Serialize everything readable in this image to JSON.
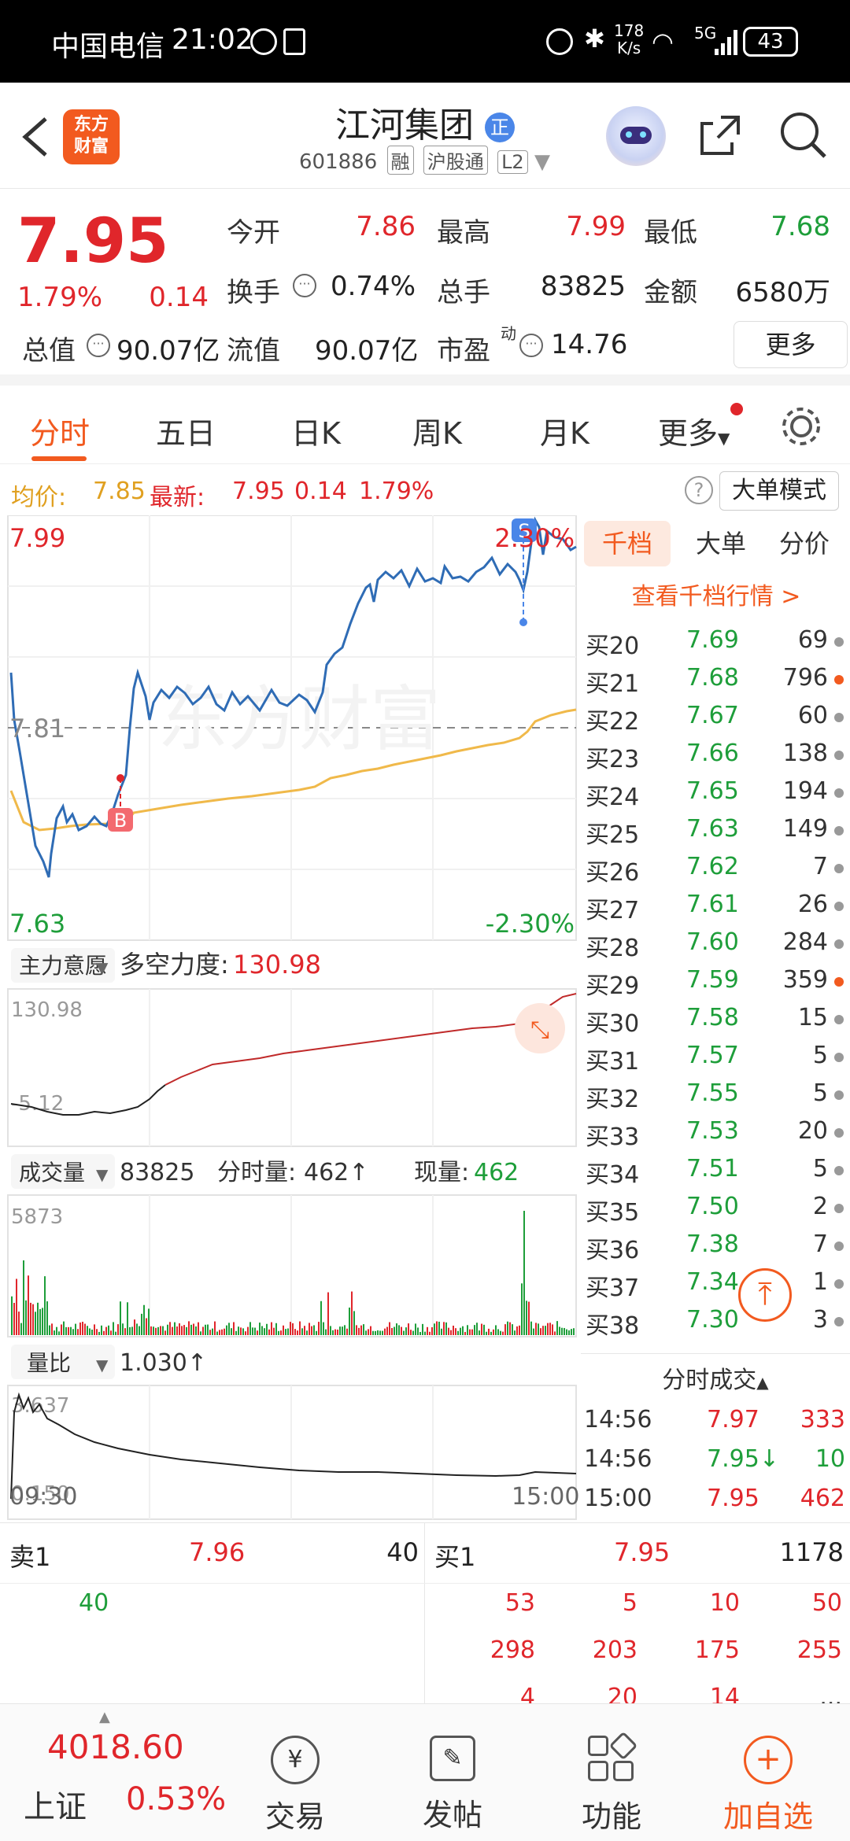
{
  "status_bar": {
    "carrier": "中国电信",
    "time": "21:02",
    "net_speed_value": "178",
    "net_speed_unit": "K/s",
    "signal": "5G",
    "battery": "43"
  },
  "header": {
    "back_icon": "chevron-left-icon",
    "logo_line1": "东方",
    "logo_line2": "财富",
    "title": "江河集团",
    "badge": "正",
    "code": "601886",
    "tags": [
      "融",
      "沪股通",
      "L2"
    ],
    "icons": [
      "assistant-avatar-icon",
      "share-icon",
      "search-icon"
    ]
  },
  "quote": {
    "price": "7.95",
    "change_pct": "1.79%",
    "change_abs": "0.14",
    "open_label": "今开",
    "open": "7.86",
    "high_label": "最高",
    "high": "7.99",
    "low_label": "最低",
    "low": "7.68",
    "turnover_label": "换手",
    "turnover": "0.74%",
    "volume_label": "总手",
    "volume": "83825",
    "amount_label": "金额",
    "amount": "6580万",
    "mktcap_label": "总值",
    "mktcap": "90.07亿",
    "float_label": "流值",
    "float": "90.07亿",
    "pe_label": "市盈",
    "pe_sup": "动",
    "pe": "14.76",
    "more": "更多"
  },
  "tabs": {
    "items": [
      "分时",
      "五日",
      "日K",
      "周K",
      "月K",
      "更多"
    ],
    "active": 0
  },
  "avg": {
    "avg_label": "均价:",
    "avg_value": "7.85",
    "last_label": "最新:",
    "last_value": "7.95",
    "chg": "0.14",
    "pct": "1.79%",
    "mode_button": "大单模式"
  },
  "intraday": {
    "top_price": "7.99",
    "top_pct": "2.30%",
    "mid_price": "7.81",
    "bottom_price": "7.63",
    "bottom_pct": "-2.30%",
    "marker_b": "B",
    "marker_s": "S",
    "watermark": "东方财富"
  },
  "indicator1": {
    "selector": "主力意愿",
    "label": "多空力度:",
    "value": "130.98",
    "axis_top": "130.98",
    "axis_bottom": "-5.12"
  },
  "indicator2": {
    "selector": "成交量",
    "volume": "83825",
    "minute_label": "分时量:",
    "minute_value": "462↑",
    "now_label": "现量:",
    "now_value": "462",
    "axis_top": "5873"
  },
  "indicator3": {
    "selector": "量比",
    "value": "1.030↑",
    "axis_top": "3.637",
    "axis_bottom": "0.150",
    "time_start": "09:30",
    "time_end": "15:00"
  },
  "orderbook": {
    "tabs": [
      "千档",
      "大单",
      "分价"
    ],
    "active": 0,
    "view_link": "查看千档行情 >",
    "rows": [
      {
        "label": "买20",
        "price": "7.69",
        "qty": "69",
        "dot": "gray"
      },
      {
        "label": "买21",
        "price": "7.68",
        "qty": "796",
        "dot": "orange"
      },
      {
        "label": "买22",
        "price": "7.67",
        "qty": "60",
        "dot": "gray"
      },
      {
        "label": "买23",
        "price": "7.66",
        "qty": "138",
        "dot": "gray"
      },
      {
        "label": "买24",
        "price": "7.65",
        "qty": "194",
        "dot": "gray"
      },
      {
        "label": "买25",
        "price": "7.63",
        "qty": "149",
        "dot": "gray"
      },
      {
        "label": "买26",
        "price": "7.62",
        "qty": "7",
        "dot": "gray"
      },
      {
        "label": "买27",
        "price": "7.61",
        "qty": "26",
        "dot": "gray"
      },
      {
        "label": "买28",
        "price": "7.60",
        "qty": "284",
        "dot": "gray"
      },
      {
        "label": "买29",
        "price": "7.59",
        "qty": "359",
        "dot": "orange"
      },
      {
        "label": "买30",
        "price": "7.58",
        "qty": "15",
        "dot": "gray"
      },
      {
        "label": "买31",
        "price": "7.57",
        "qty": "5",
        "dot": "gray"
      },
      {
        "label": "买32",
        "price": "7.55",
        "qty": "5",
        "dot": "gray"
      },
      {
        "label": "买33",
        "price": "7.53",
        "qty": "20",
        "dot": "gray"
      },
      {
        "label": "买34",
        "price": "7.51",
        "qty": "5",
        "dot": "gray"
      },
      {
        "label": "买35",
        "price": "7.50",
        "qty": "2",
        "dot": "gray"
      },
      {
        "label": "买36",
        "price": "7.38",
        "qty": "7",
        "dot": "gray"
      },
      {
        "label": "买37",
        "price": "7.34",
        "qty": "1",
        "dot": "gray"
      },
      {
        "label": "买38",
        "price": "7.30",
        "qty": "3",
        "dot": "gray"
      }
    ],
    "trades_title": "分时成交",
    "trades": [
      {
        "time": "14:56",
        "price": "7.97",
        "qty": "333",
        "color": "red"
      },
      {
        "time": "14:56",
        "price": "7.95↓",
        "qty": "10",
        "color": "green"
      },
      {
        "time": "15:00",
        "price": "7.95",
        "qty": "462",
        "color": "red"
      }
    ]
  },
  "book_bottom": {
    "sell_label": "卖1",
    "sell_price": "7.96",
    "sell_qty": "40",
    "buy_label": "买1",
    "buy_price": "7.95",
    "buy_qty": "1178",
    "sell_queue": [
      "40"
    ],
    "buy_queue": [
      "53",
      "5",
      "10",
      "50",
      "298",
      "203",
      "175",
      "255",
      "4",
      "20",
      "14",
      "..."
    ]
  },
  "bottom_nav": {
    "index_value": "4018.60",
    "index_name": "上证",
    "index_pct": "0.53%",
    "items": [
      {
        "label": "交易",
        "icon": "yen-cycle-icon"
      },
      {
        "label": "发帖",
        "icon": "edit-icon"
      },
      {
        "label": "功能",
        "icon": "grid-icon"
      },
      {
        "label": "加自选",
        "icon": "plus-circle-icon"
      }
    ]
  },
  "colors": {
    "up": "#e0262b",
    "down": "#1e9e3a",
    "brand": "#f25a1f",
    "price_line": "#2f6cb5",
    "avg_line": "#f0b94a"
  }
}
